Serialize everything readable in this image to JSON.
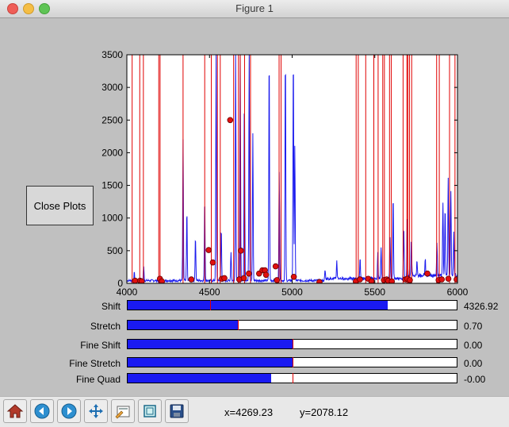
{
  "window": {
    "title": "Figure 1"
  },
  "close_button": {
    "label": "Close Plots"
  },
  "toolbar": {
    "buttons": [
      "home-icon",
      "back-icon",
      "forward-icon",
      "pan-icon",
      "configure-subplots-icon",
      "zoom-icon",
      "save-icon"
    ],
    "coord_x": "x=4269.23",
    "coord_y": "y=2078.12"
  },
  "sliders": [
    {
      "label": "Shift",
      "value_text": "4326.92",
      "fill": 0.79,
      "init": 0.25
    },
    {
      "label": "Stretch",
      "value_text": "0.70",
      "fill": 0.335,
      "init": 0.335
    },
    {
      "label": "Fine Shift",
      "value_text": "0.00",
      "fill": 0.5,
      "init": 0.5
    },
    {
      "label": "Fine Stretch",
      "value_text": "0.00",
      "fill": 0.5,
      "init": 0.5
    },
    {
      "label": "Fine Quad",
      "value_text": "-0.00",
      "fill": 0.436,
      "init": 0.5
    }
  ],
  "chart_data": {
    "type": "line",
    "xlim": [
      4000,
      6000
    ],
    "ylim": [
      0,
      3500
    ],
    "xticks": [
      4000,
      4500,
      5000,
      5500,
      6000
    ],
    "yticks": [
      0,
      500,
      1000,
      1500,
      2000,
      2500,
      3000,
      3500
    ],
    "colors": {
      "spectrum": "#1a1aee",
      "lines": "#e00000",
      "markers": "#e01010"
    },
    "spectrum_peaks": [
      {
        "x": 4045,
        "y": 120
      },
      {
        "x": 4102,
        "y": 210
      },
      {
        "x": 4340,
        "y": 2150
      },
      {
        "x": 4363,
        "y": 1080
      },
      {
        "x": 4415,
        "y": 680
      },
      {
        "x": 4471,
        "y": 1270
      },
      {
        "x": 4540,
        "y": 3500
      },
      {
        "x": 4571,
        "y": 800
      },
      {
        "x": 4630,
        "y": 440
      },
      {
        "x": 4658,
        "y": 3500
      },
      {
        "x": 4686,
        "y": 3500
      },
      {
        "x": 4711,
        "y": 2850
      },
      {
        "x": 4740,
        "y": 3500
      },
      {
        "x": 4762,
        "y": 2250
      },
      {
        "x": 4861,
        "y": 3500
      },
      {
        "x": 4922,
        "y": 1680
      },
      {
        "x": 4959,
        "y": 3500
      },
      {
        "x": 5007,
        "y": 3500
      },
      {
        "x": 5016,
        "y": 2050
      },
      {
        "x": 5199,
        "y": 160
      },
      {
        "x": 5270,
        "y": 280
      },
      {
        "x": 5411,
        "y": 320
      },
      {
        "x": 5518,
        "y": 390
      },
      {
        "x": 5538,
        "y": 480
      },
      {
        "x": 5592,
        "y": 620
      },
      {
        "x": 5611,
        "y": 1300
      },
      {
        "x": 5675,
        "y": 800
      },
      {
        "x": 5696,
        "y": 900
      },
      {
        "x": 5721,
        "y": 560
      },
      {
        "x": 5755,
        "y": 230
      },
      {
        "x": 5805,
        "y": 260
      },
      {
        "x": 5876,
        "y": 500
      },
      {
        "x": 5912,
        "y": 1100
      },
      {
        "x": 5925,
        "y": 1060
      },
      {
        "x": 5944,
        "y": 1500
      },
      {
        "x": 5960,
        "y": 1300
      },
      {
        "x": 5978,
        "y": 650
      }
    ],
    "vlines": [
      4032,
      4078,
      4100,
      4193,
      4201,
      4340,
      4471,
      4511,
      4548,
      4565,
      4646,
      4675,
      4686,
      4712,
      4748,
      4921,
      4933,
      5387,
      5400,
      5445,
      5494,
      5520,
      5548,
      5558,
      5589,
      5600,
      5671,
      5694,
      5700,
      5710,
      5723,
      5874,
      5890,
      5952,
      5985
    ],
    "markers": [
      {
        "x": 4050,
        "y": 40
      },
      {
        "x": 4080,
        "y": 40
      },
      {
        "x": 4090,
        "y": 30
      },
      {
        "x": 4200,
        "y": 70
      },
      {
        "x": 4212,
        "y": 30
      },
      {
        "x": 4390,
        "y": 60
      },
      {
        "x": 4495,
        "y": 510
      },
      {
        "x": 4520,
        "y": 320
      },
      {
        "x": 4575,
        "y": 70
      },
      {
        "x": 4590,
        "y": 80
      },
      {
        "x": 4625,
        "y": 2500
      },
      {
        "x": 4680,
        "y": 60
      },
      {
        "x": 4690,
        "y": 500
      },
      {
        "x": 4708,
        "y": 80
      },
      {
        "x": 4738,
        "y": 150
      },
      {
        "x": 4800,
        "y": 150
      },
      {
        "x": 4820,
        "y": 200
      },
      {
        "x": 4835,
        "y": 200
      },
      {
        "x": 4842,
        "y": 130
      },
      {
        "x": 4900,
        "y": 260
      },
      {
        "x": 4908,
        "y": 50
      },
      {
        "x": 5010,
        "y": 100
      },
      {
        "x": 5165,
        "y": 20
      },
      {
        "x": 5385,
        "y": 30
      },
      {
        "x": 5410,
        "y": 60
      },
      {
        "x": 5460,
        "y": 70
      },
      {
        "x": 5480,
        "y": 30
      },
      {
        "x": 5555,
        "y": 50
      },
      {
        "x": 5572,
        "y": 60
      },
      {
        "x": 5581,
        "y": 40
      },
      {
        "x": 5603,
        "y": 30
      },
      {
        "x": 5685,
        "y": 60
      },
      {
        "x": 5697,
        "y": 70
      },
      {
        "x": 5712,
        "y": 50
      },
      {
        "x": 5818,
        "y": 150
      },
      {
        "x": 5886,
        "y": 50
      },
      {
        "x": 5905,
        "y": 60
      },
      {
        "x": 5945,
        "y": 70
      },
      {
        "x": 5995,
        "y": 60
      }
    ]
  }
}
